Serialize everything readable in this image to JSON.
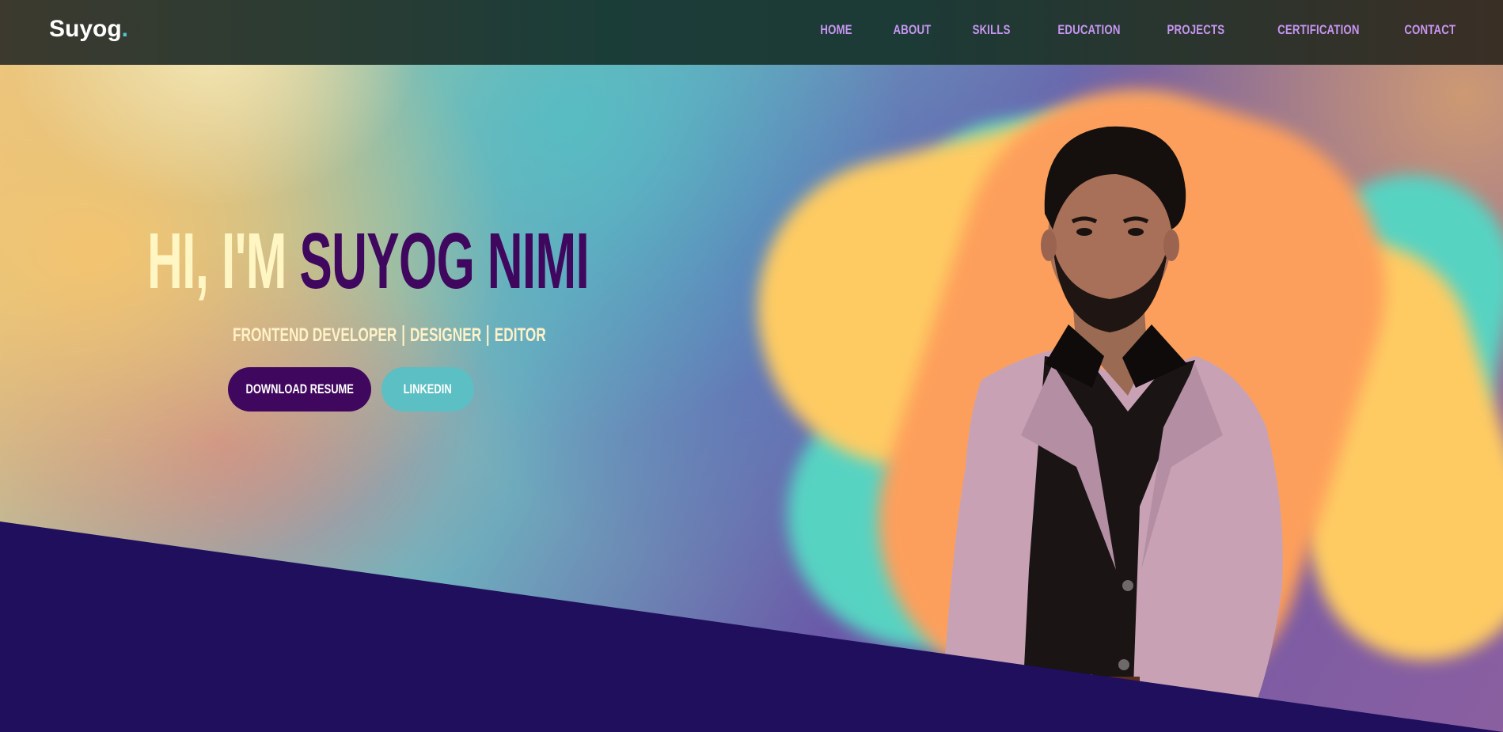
{
  "brand": {
    "name": "Suyog",
    "dot": "."
  },
  "nav": {
    "items": [
      {
        "label": "HOME"
      },
      {
        "label": "ABOUT"
      },
      {
        "label": "SKILLS"
      },
      {
        "label": "EDUCATION"
      },
      {
        "label": "PROJECTS"
      },
      {
        "label": "CERTIFICATION"
      },
      {
        "label": "CONTACT"
      }
    ]
  },
  "hero": {
    "greeting": "HI, I'M ",
    "name": "SUYOG NIMI",
    "roles": [
      "FRONTEND DEVELOPER",
      "DESIGNER",
      "EDITOR"
    ],
    "buttons": {
      "resume": "DOWNLOAD RESUME",
      "linkedin": "LINKEDIN"
    }
  },
  "colors": {
    "accent_purple": "#40075e",
    "accent_teal": "#5bbfc4",
    "nav_text": "#c896f2",
    "band": "#1f0f5c"
  }
}
